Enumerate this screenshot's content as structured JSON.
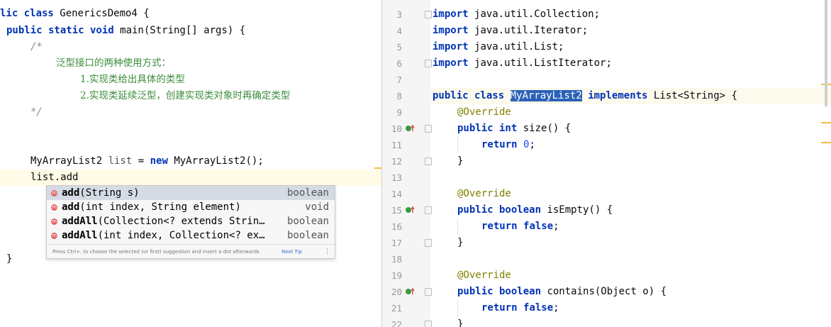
{
  "left_editor": {
    "lines": [
      "lic class GenericsDemo4 {",
      " public static void main(String[] args) {",
      "     /*",
      "         泛型接口的两种使用方式：",
      "             1.实现类给出具体的类型",
      "             2.实现类延续泛型，创建实现类对象时再确定类型",
      "     */",
      "",
      "",
      "     MyArrayList2 list = new MyArrayList2();",
      "     list.add",
      "",
      "",
      "",
      "",
      " }"
    ],
    "decl_prefix": "MyArrayList2 ",
    "decl_var": "list",
    "decl_eq": " = ",
    "decl_new": "new",
    "decl_rest": " MyArrayList2();",
    "current_line": "list.add",
    "comment_open": "/*",
    "comment_close": "*/",
    "comment_line1": "泛型接口的两种使用方式：",
    "comment_line2": "1.实现类给出具体的类型",
    "comment_line3": "2.实现类延续泛型，创建实现类对象时再确定类型",
    "line1_kw": "lic class",
    "line1_rest": " GenericsDemo4 {",
    "line2_kw1": "public static void",
    "line2_rest": " main(String[] args) {",
    "closing_brace": "}"
  },
  "completion_popup": {
    "items": [
      {
        "name": "add",
        "params": "(String s)",
        "type": "boolean"
      },
      {
        "name": "add",
        "params": "(int index, String element)",
        "type": "void"
      },
      {
        "name": "addAll",
        "params": "(Collection<? extends Strin…",
        "type": "boolean"
      },
      {
        "name": "addAll",
        "params": "(int index, Collection<? ex…",
        "type": "boolean"
      }
    ],
    "footer_text": "Press Ctrl+. to choose the selected (or first) suggestion and insert a dot afterwards",
    "footer_link": "Next Tip",
    "selected_index": 0
  },
  "right_editor": {
    "line_numbers": [
      "3",
      "4",
      "5",
      "6",
      "7",
      "8",
      "9",
      "10",
      "11",
      "12",
      "13",
      "14",
      "15",
      "16",
      "17",
      "18",
      "19",
      "20",
      "21",
      "22"
    ],
    "imp1": "java.util.Collection;",
    "imp2": "java.util.Iterator;",
    "imp3": "java.util.List;",
    "imp4": "java.util.ListIterator;",
    "import_kw": "import",
    "class_kw": "public class",
    "class_name": "MyArrayList2",
    "implements_kw": "implements",
    "class_rest": " List<String> {",
    "override": "@Override",
    "m1_kw": "public int",
    "m1_rest": " size() {",
    "ret_kw": "return",
    "ret_zero": "0",
    "semi": ";",
    "close": "}",
    "m2_kw": "public boolean",
    "m2_rest": " isEmpty() {",
    "ret_false": "false",
    "m3_rest": " contains(Object o) {"
  },
  "colors": {
    "keyword": "#0033b3",
    "annotation": "#808000",
    "comment": "#8c8c8c",
    "number": "#1750eb",
    "selection": "#2b62b8"
  }
}
